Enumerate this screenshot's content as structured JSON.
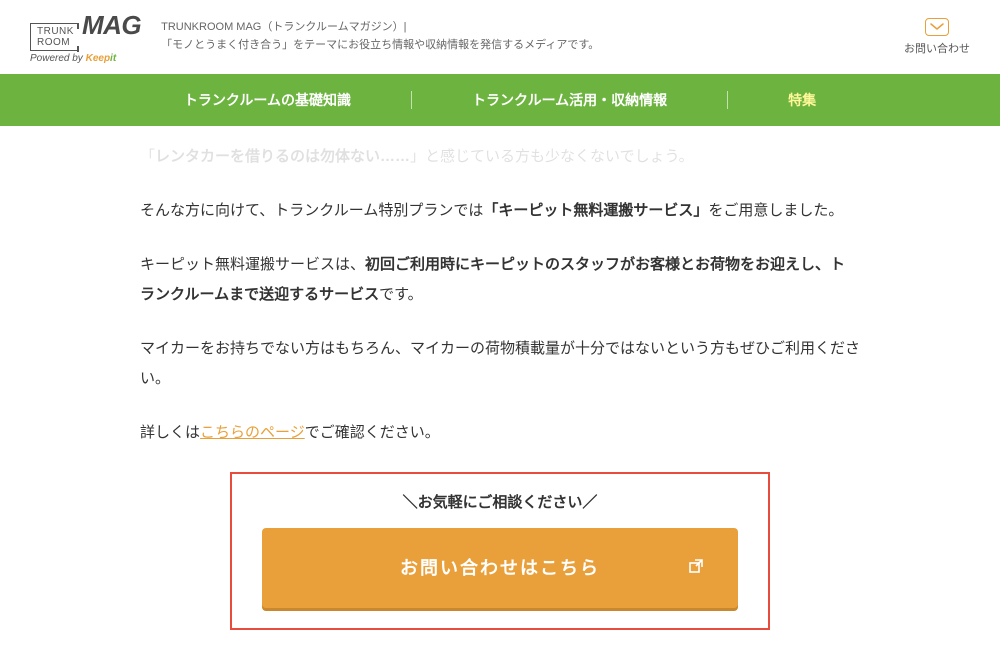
{
  "header": {
    "logo_trunk_line1": "TRUNK",
    "logo_trunk_line2": "ROOM",
    "logo_mag": "MAG",
    "logo_sub_prefix": "Powered by ",
    "logo_sub_keep": "Keep",
    "logo_sub_it": "it",
    "desc_line1": "TRUNKROOM MAG（トランクルームマガジン）|",
    "desc_line2": "「モノとうまく付き合う」をテーマにお役立ち情報や収納情報を発信するメディアです。",
    "contact_label": "お問い合わせ"
  },
  "nav": {
    "items": [
      {
        "label": "トランクルームの基礎知識",
        "active": false
      },
      {
        "label": "トランクルーム活用・収納情報",
        "active": false
      },
      {
        "label": "特集",
        "active": true
      }
    ]
  },
  "article": {
    "line0_pre": "「",
    "line0_bold": "レンタカーを借りるのは勿体ない……",
    "line0_post": "」と感じている方も少なくないでしょう。",
    "line1_pre": "そんな方に向けて、トランクルーム特別プランでは",
    "line1_bold": "「キーピット無料運搬サービス」",
    "line1_post": "をご用意しました。",
    "line2_pre": "キーピット無料運搬サービスは、",
    "line2_bold": "初回ご利用時にキーピットのスタッフがお客様とお荷物をお迎えし、トランクルームまで送迎するサービス",
    "line2_post": "です。",
    "line3": "マイカーをお持ちでない方はもちろん、マイカーの荷物積載量が十分ではないという方もぜひご利用ください。",
    "line4_pre": "詳しくは",
    "line4_link": "こちらのページ",
    "line4_post": "でご確認ください。"
  },
  "cta": {
    "lead": "＼お気軽にご相談ください／",
    "button": "お問い合わせはこちら"
  }
}
